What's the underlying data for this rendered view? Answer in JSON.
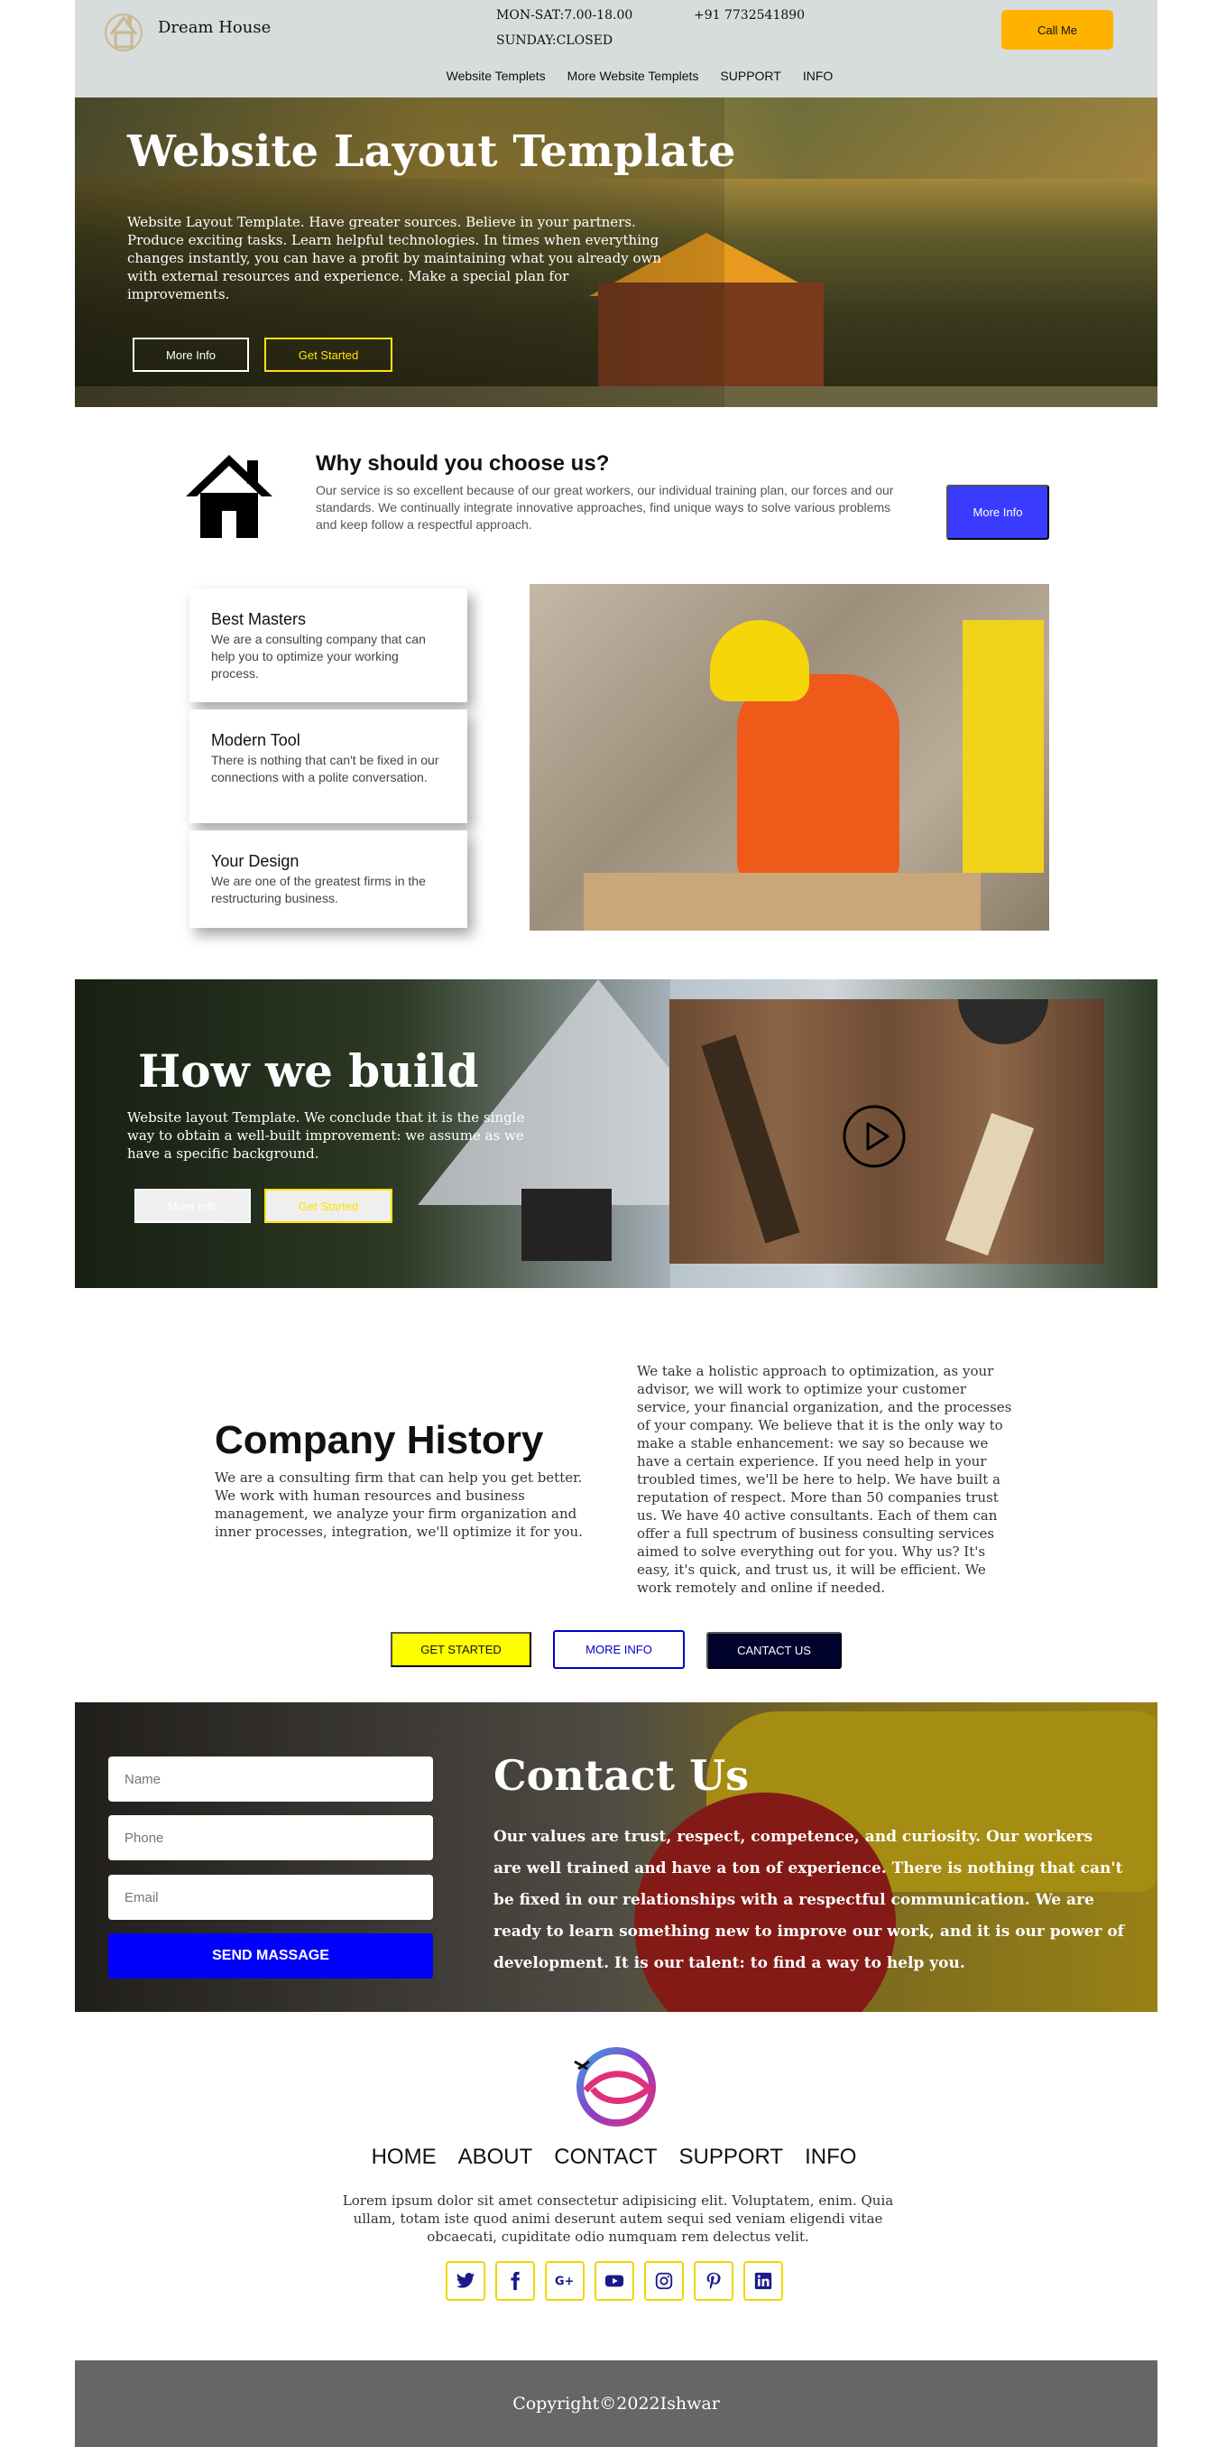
{
  "header": {
    "brand": "Dream House",
    "hours_weekday": "MON-SAT:7.00-18.00",
    "hours_sunday": "SUNDAY:CLOSED",
    "phone": "+91 7732541890",
    "call_button": "Call Me",
    "nav": [
      "Website Templets",
      "More Website Templets",
      "SUPPORT",
      "INFO"
    ]
  },
  "hero": {
    "title": "Website Layout Template",
    "text": "Website Layout Template. Have greater sources. Believe in your partners. Produce exciting tasks. Learn helpful technologies. In times when everything changes instantly, you can have a profit by maintaining what you already own with external resources and experience. Make a special plan for improvements.",
    "more_button": "More Info",
    "start_button": "Get Started"
  },
  "why": {
    "title": "Why should you choose us?",
    "text": "Our service is so excellent because of our great workers, our individual training plan, our forces and our standards. We continually integrate innovative approaches, find unique ways to solve various problems and keep follow a respectful approach.",
    "button": "More Info"
  },
  "features": [
    {
      "title": "Best Masters",
      "text": "We are a consulting company that can help you to optimize your working process."
    },
    {
      "title": "Modern Tool",
      "text": "There is nothing that can't be fixed in our connections with a polite conversation."
    },
    {
      "title": "Your Design",
      "text": "We are one of the greatest firms in the restructuring business."
    }
  ],
  "build": {
    "title": "How we build",
    "text": "Website layout Template. We conclude that it is the single way to obtain a well-built improvement: we assume as we have a specific background.",
    "more_button": "More Info",
    "start_button": "Get Started"
  },
  "history": {
    "title": "Company History",
    "left_text": "We are a consulting firm that can help you get better. We work with human resources and business management, we analyze your firm organization and inner processes, integration, we'll optimize it for you.",
    "right_text": "We take a holistic approach to optimization, as your advisor, we will work to optimize your customer service, your financial organization, and the processes of your company. We believe that it is the only way to make a stable enhancement: we say so because we have a certain experience. If you need help in your troubled times, we'll be here to help. We have built a reputation of respect. More than 50 companies trust us. We have 40 active consultants. Each of them can offer a full spectrum of business consulting services aimed to solve everything out for you. Why us? It's easy, it's quick, and trust us, it will be efficient. We work remotely and online if needed.",
    "buttons": {
      "get_started": "GET STARTED",
      "more_info": "MORE INFO",
      "contact": "CANTACT US"
    }
  },
  "contact": {
    "name_placeholder": "Name",
    "phone_placeholder": "Phone",
    "email_placeholder": "Email",
    "send_button": "SEND MASSAGE",
    "title": "Contact Us",
    "text": "Our values are trust, respect, competence, and curiosity. Our workers are well trained and have a ton of experience. There is nothing that can't be fixed in our relationships with a respectful communication. We are ready to learn something new to improve our work, and it is our power of development. It is our talent: to find a way to help you."
  },
  "footer": {
    "nav": [
      "HOME",
      "ABOUT",
      "CONTACT",
      "SUPPORT",
      "INFO"
    ],
    "text": "Lorem ipsum dolor sit amet consectetur adipisicing elit. Voluptatem, enim. Quia ullam, totam iste quod animi deserunt autem sequi sed veniam eligendi vitae obcaecati, cupiditate odio numquam rem delectus velit.",
    "social_icons": [
      "twitter-icon",
      "facebook-icon",
      "google-plus-icon",
      "youtube-icon",
      "instagram-icon",
      "pinterest-icon",
      "linkedin-icon"
    ],
    "copyright": "Copyright©2022Ishwar"
  },
  "colors": {
    "header_bg": "#d7dcdc",
    "call_button": "#ffb300",
    "why_button": "#3b3bff",
    "send_button": "#0000ff",
    "get_started_yellow": "#ffff00",
    "contact_button": "#02022e",
    "social_icon": "#1a1a8c",
    "footer_bar": "#666666"
  }
}
